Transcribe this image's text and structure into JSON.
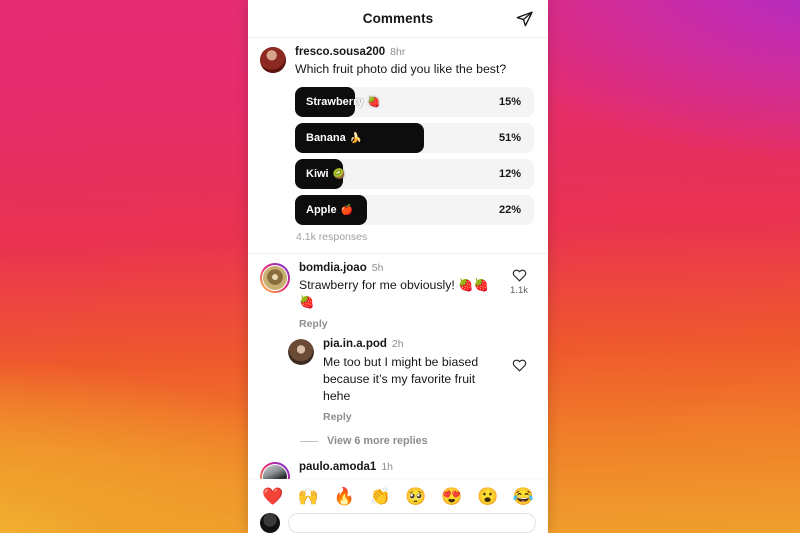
{
  "background": {
    "gradient_colors": [
      "#e62d74",
      "#a82cc8",
      "#ea3350",
      "#ef5a2c",
      "#efa02d",
      "#f6c33a"
    ]
  },
  "header": {
    "title": "Comments",
    "share_icon": "paper-plane-icon"
  },
  "poll_comment": {
    "username": "fresco.sousa200",
    "time": "8hr",
    "question": "Which fruit photo did you like the best?",
    "responses_label": "4.1k responses"
  },
  "chart_data": {
    "type": "bar",
    "title": "Which fruit photo did you like the best?",
    "categories": [
      "Strawberry",
      "Banana",
      "Kiwi",
      "Apple"
    ],
    "values": [
      15,
      51,
      12,
      22
    ],
    "emojis": [
      "🍓",
      "🍌",
      "🥝",
      "🍎"
    ],
    "bar_widths_pct": [
      25,
      54,
      20,
      30
    ],
    "value_labels": [
      "15%",
      "51%",
      "12%",
      "22%"
    ],
    "xlabel": "",
    "ylabel": "",
    "ylim": [
      0,
      100
    ],
    "total_responses": "4.1k responses",
    "orientation": "horizontal",
    "grid": false,
    "legend": "none",
    "fill_color": "#0d0d0d",
    "track_color": "#f4f4f4"
  },
  "comments": [
    {
      "username": "bomdia.joao",
      "time": "5h",
      "text": "Strawberry for me obviously! 🍓🍓🍓",
      "reply_label": "Reply",
      "likes": "1.1k",
      "heart_icon": "heart-outline-icon",
      "indented": false,
      "avatar_class": "av-b",
      "has_story_ring": true
    },
    {
      "username": "pia.in.a.pod",
      "time": "2h",
      "text": "Me too but I might be biased because it’s my favorite fruit hehe",
      "reply_label": "Reply",
      "likes": "",
      "heart_icon": "heart-outline-icon",
      "indented": true,
      "avatar_class": "av-c",
      "has_story_ring": false
    }
  ],
  "view_more": {
    "label": "View 6 more replies"
  },
  "last_comment": {
    "username": "paulo.amoda1",
    "time": "1h",
    "avatar_class": "av-d"
  },
  "emoji_bar": {
    "emojis": [
      "❤️",
      "🙌",
      "🔥",
      "👏",
      "🥺",
      "😍",
      "😮",
      "😂"
    ],
    "names": [
      "red-heart-emoji",
      "raising-hands-emoji",
      "fire-emoji",
      "clapping-hands-emoji",
      "pleading-face-emoji",
      "heart-eyes-emoji",
      "open-mouth-emoji",
      "joy-emoji"
    ]
  }
}
